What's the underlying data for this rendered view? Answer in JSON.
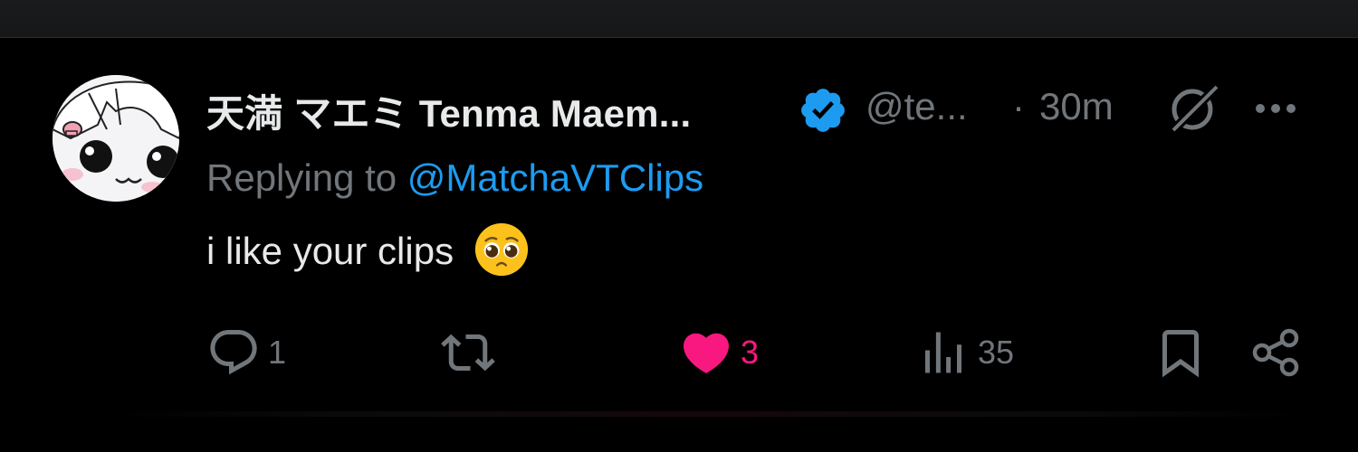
{
  "tweet": {
    "author": {
      "display_name": "天満 マエミ Tenma Maem...",
      "handle": "@te...",
      "verified": true,
      "avatar_icon": "avatar-cartoon-girl"
    },
    "separator": "·",
    "time": "30m",
    "reply": {
      "prefix": "Replying to",
      "mention": "@MatchaVTClips"
    },
    "text": "i like your clips",
    "emoji": "pleading-face",
    "actions": {
      "reply_count": "1",
      "retweet_count": "",
      "like_count": "3",
      "views_count": "35"
    }
  },
  "colors": {
    "background": "#000000",
    "text": "#e7e9ea",
    "muted": "#71767b",
    "accent": "#1d9bf0",
    "like": "#f91880"
  }
}
